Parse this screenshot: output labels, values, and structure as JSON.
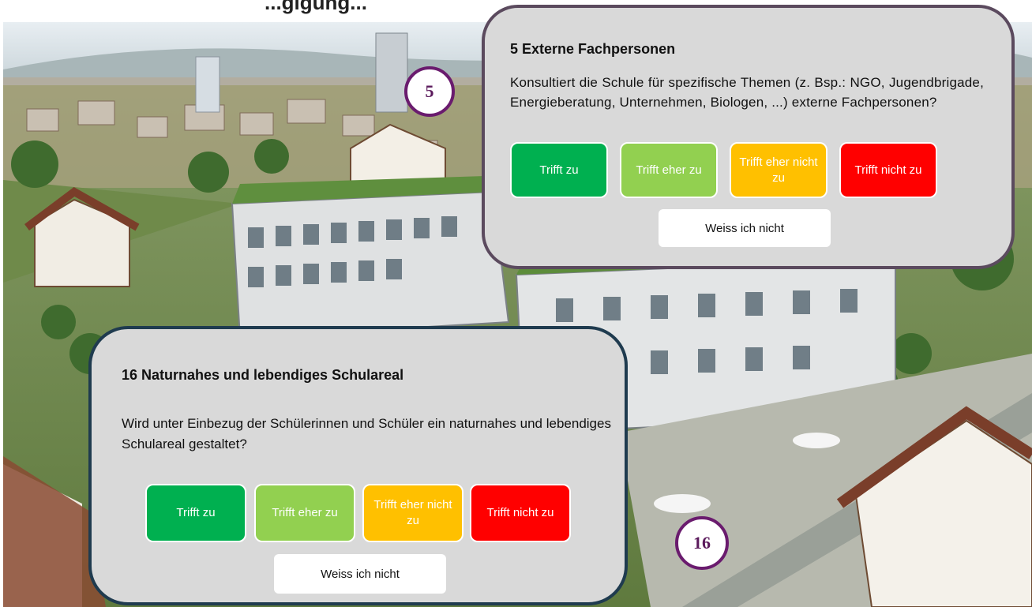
{
  "top_banner": {
    "text": "...gigung..."
  },
  "markers": [
    {
      "number": "5"
    },
    {
      "number": "16"
    }
  ],
  "question_5": {
    "title": "5  Externe Fachpersonen",
    "text": "Konsultiert die Schule für spezifische Themen  (z. Bsp.: NGO, Jugendbrigade, Energieberatung, Unternehmen, Biologen, ...)  externe Fachpersonen?",
    "answers": [
      "Trifft zu",
      "Trifft eher zu",
      "Trifft eher nicht zu",
      "Trifft nicht zu"
    ],
    "unknown": "Weiss ich nicht"
  },
  "question_16": {
    "title": "16 Naturnahes und lebendiges Schulareal",
    "text": "Wird unter Einbezug der Schülerinnen und Schüler ein naturnahes und lebendiges Schulareal gestaltet?",
    "answers": [
      "Trifft zu",
      "Trifft eher zu",
      "Trifft eher nicht zu",
      "Trifft nicht zu"
    ],
    "unknown": "Weiss ich nicht"
  },
  "colors": {
    "trifft_zu": "#00b050",
    "trifft_eher_zu": "#92d050",
    "trifft_eher_nicht_zu": "#ffc000",
    "trifft_nicht_zu": "#ff0000",
    "panel_bg": "#d9d9d9",
    "marker_border": "#6a1b6e"
  }
}
